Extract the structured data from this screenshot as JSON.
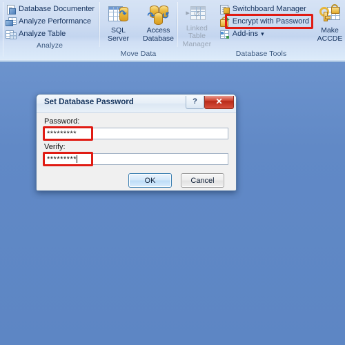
{
  "ribbon": {
    "groups": [
      {
        "label": "Analyze",
        "commands": [
          {
            "label": "Database Documenter",
            "icon": "database-documenter-icon",
            "disabled": false
          },
          {
            "label": "Analyze Performance",
            "icon": "analyze-performance-icon",
            "disabled": false
          },
          {
            "label": "Analyze Table",
            "icon": "analyze-table-icon",
            "disabled": false
          }
        ]
      },
      {
        "label": "Move Data",
        "buttons": [
          {
            "line1": "SQL",
            "line2": "Server",
            "icon": "sql-server-icon",
            "disabled": false
          },
          {
            "line1": "Access",
            "line2": "Database",
            "icon": "access-database-icon",
            "disabled": false
          }
        ]
      },
      {
        "label": "Database Tools",
        "buttons": [
          {
            "line1": "Linked Table",
            "line2": "Manager",
            "icon": "linked-table-manager-icon",
            "disabled": true
          }
        ],
        "commands": [
          {
            "label": "Switchboard Manager",
            "icon": "switchboard-manager-icon",
            "disabled": false
          },
          {
            "label": "Encrypt with Password",
            "icon": "encrypt-with-password-icon",
            "disabled": false,
            "highlighted": true
          },
          {
            "label": "Add-ins",
            "icon": "add-ins-icon",
            "disabled": false,
            "dropdown": true,
            "caret": "▾"
          }
        ],
        "trailing_buttons": [
          {
            "line1": "Make",
            "line2": "ACCDE",
            "icon": "make-accde-icon",
            "disabled": false
          }
        ]
      }
    ]
  },
  "dialog": {
    "title": "Set Database Password",
    "help_button": "?",
    "close_button": "✕",
    "password": {
      "label": "Password:",
      "value": "*********",
      "placeholder": ""
    },
    "verify": {
      "label": "Verify:",
      "value": "*********",
      "placeholder": ""
    },
    "ok_button": "OK",
    "cancel_button": "Cancel"
  },
  "annotations": {
    "color": "#e01b13",
    "targets": [
      "encrypt-with-password-command",
      "password-input",
      "verify-input"
    ]
  },
  "theme": {
    "workspace_background": "#6089c6",
    "ribbon_background": "#ccdbef",
    "accent_blue": "#2f72c4",
    "group_label_color": "#3d5a80"
  }
}
